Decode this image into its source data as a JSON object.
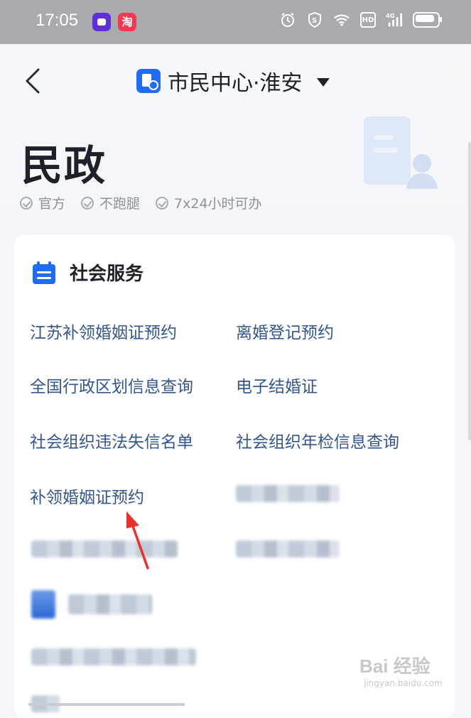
{
  "status_bar": {
    "time": "17:05",
    "app_b_label": "淘",
    "hd": "HD",
    "net": "4G"
  },
  "header": {
    "title": "市民中心·淮安",
    "page_title": "民政",
    "tags": [
      "官方",
      "不跑腿",
      "7x24小时可办"
    ]
  },
  "section": {
    "title": "社会服务",
    "services": [
      "江苏补领婚姻证预约",
      "离婚登记预约",
      "全国行政区划信息查询",
      "电子结婚证",
      "社会组织违法失信名单",
      "社会组织年检信息查询",
      "补领婚姻证预约"
    ]
  },
  "watermark": {
    "main": "Bai 经验",
    "sub": "jingyan.baidu.com"
  },
  "colors": {
    "accent": "#1f6cf5",
    "link": "#34568b",
    "arrow": "#e8322b"
  }
}
